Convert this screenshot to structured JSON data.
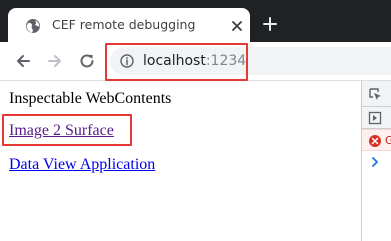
{
  "tab": {
    "title": "CEF remote debugging",
    "favicon": "globe-icon",
    "close_icon": "close-icon"
  },
  "new_tab_icon": "plus-icon",
  "toolbar": {
    "back_icon": "arrow-back-icon",
    "forward_icon": "arrow-forward-icon",
    "reload_icon": "reload-icon",
    "site_info_icon": "info-icon",
    "url_host": "localhost",
    "url_port": ":1234"
  },
  "page": {
    "heading": "Inspectable WebContents",
    "links": [
      {
        "label": "Image 2 Surface",
        "state": "visited"
      },
      {
        "label": "Data View Application",
        "state": "unvisited"
      }
    ]
  },
  "devtools": {
    "error_letter": "G"
  },
  "colors": {
    "highlight": "#e53935",
    "visited_link": "#551a8b",
    "link": "#0000ee",
    "tabstrip": "#202124"
  }
}
